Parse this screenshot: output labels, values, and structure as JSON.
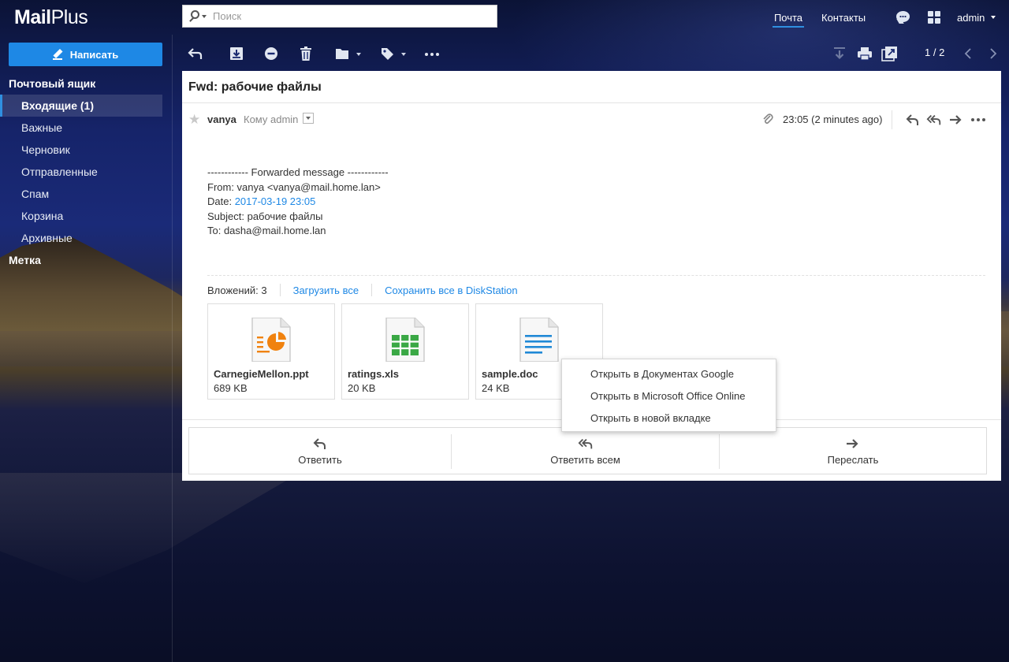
{
  "app": {
    "logo_main": "Mail",
    "logo_plus": "Plus"
  },
  "search": {
    "placeholder": "Поиск"
  },
  "topnav": {
    "mail": "Почта",
    "contacts": "Контакты",
    "user": "admin"
  },
  "sidebar": {
    "compose_label": "Написать",
    "mailbox_header": "Почтовый ящик",
    "items": [
      {
        "label": "Входящие (1)",
        "active": true
      },
      {
        "label": "Важные"
      },
      {
        "label": "Черновик"
      },
      {
        "label": "Отправленные"
      },
      {
        "label": "Спам"
      },
      {
        "label": "Корзина"
      },
      {
        "label": "Архивные"
      }
    ],
    "label_header": "Метка"
  },
  "toolbar": {
    "pager": "1 / 2"
  },
  "message": {
    "subject": "Fwd: рабочие файлы",
    "from": "vanya",
    "to": "Кому admin",
    "time": "23:05 (2 minutes ago)",
    "body": {
      "forwarded_line": "------------ Forwarded message ------------",
      "from_line": "From: vanya <vanya@mail.home.lan>",
      "date_prefix": "Date: ",
      "date_value": "2017-03-19 23:05",
      "subject_line": "Subject: рабочие файлы",
      "to_line": "To: dasha@mail.home.lan"
    }
  },
  "attachments": {
    "label": "Вложений:",
    "count": "3",
    "download_all": "Загрузить все",
    "save_all": "Сохранить все в DiskStation",
    "files": [
      {
        "name": "CarnegieMellon.ppt",
        "size": "689 KB",
        "icon": "ppt-file-icon",
        "color": "#f0820f"
      },
      {
        "name": "ratings.xls",
        "size": "20 KB",
        "icon": "xls-file-icon",
        "color": "#3aa845"
      },
      {
        "name": "sample.doc",
        "size": "24 KB",
        "icon": "doc-file-icon",
        "color": "#2089d6"
      }
    ]
  },
  "context_menu": {
    "items": [
      "Открыть в Документах Google",
      "Открыть в Microsoft Office Online",
      "Открыть в новой вкладке"
    ]
  },
  "reply_bar": {
    "reply": "Ответить",
    "reply_all": "Ответить всем",
    "forward": "Переслать"
  },
  "colors": {
    "accent": "#1e88e5",
    "panel": "#ffffff"
  }
}
